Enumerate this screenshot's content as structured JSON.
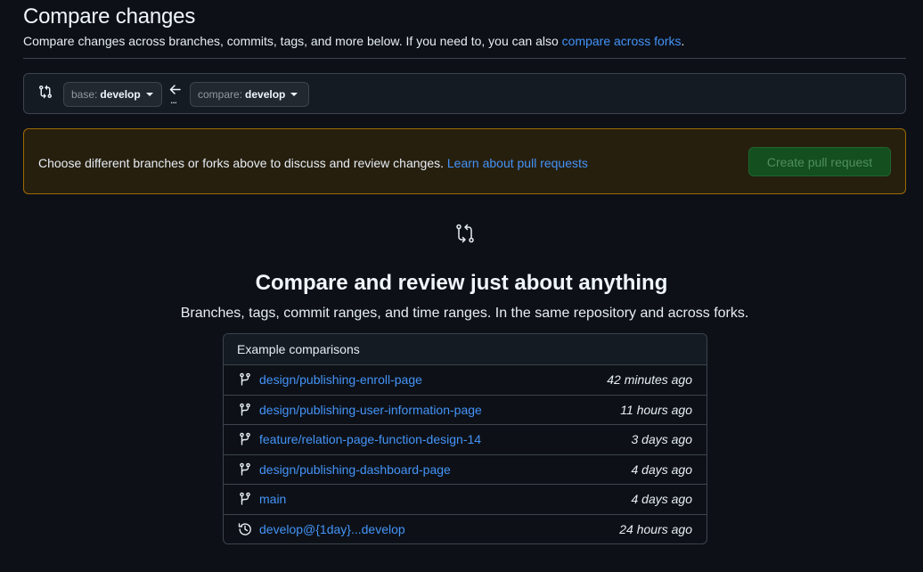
{
  "header": {
    "title": "Compare changes",
    "subtitle_text": "Compare changes across branches, commits, tags, and more below. If you need to, you can also ",
    "subtitle_link": "compare across forks",
    "subtitle_end": "."
  },
  "range": {
    "icon": "git-compare-icon",
    "base_label": "base:",
    "base_value": "develop",
    "arrow_icon": "arrow-left-icon",
    "dots": "...",
    "compare_label": "compare:",
    "compare_value": "develop"
  },
  "flash": {
    "text": "Choose different branches or forks above to discuss and review changes. ",
    "link": "Learn about pull requests",
    "button": "Create pull request"
  },
  "blankslate": {
    "icon": "git-compare-icon",
    "title": "Compare and review just about anything",
    "description": "Branches, tags, commit ranges, and time ranges. In the same repository and across forks."
  },
  "examples": {
    "header": "Example comparisons",
    "rows": [
      {
        "icon": "git-branch-icon",
        "name": "design/publishing-enroll-page",
        "time": "42 minutes ago"
      },
      {
        "icon": "git-branch-icon",
        "name": "design/publishing-user-information-page",
        "time": "11 hours ago"
      },
      {
        "icon": "git-branch-icon",
        "name": "feature/relation-page-function-design-14",
        "time": "3 days ago"
      },
      {
        "icon": "git-branch-icon",
        "name": "design/publishing-dashboard-page",
        "time": "4 days ago"
      },
      {
        "icon": "git-branch-icon",
        "name": "main",
        "time": "4 days ago"
      },
      {
        "icon": "history-icon",
        "name": "develop@{1day}...develop",
        "time": "24 hours ago"
      }
    ]
  },
  "colors": {
    "background": "#0d1117",
    "link": "#4493f8",
    "flash_border": "#9e6a03",
    "button_green": "#105823"
  }
}
